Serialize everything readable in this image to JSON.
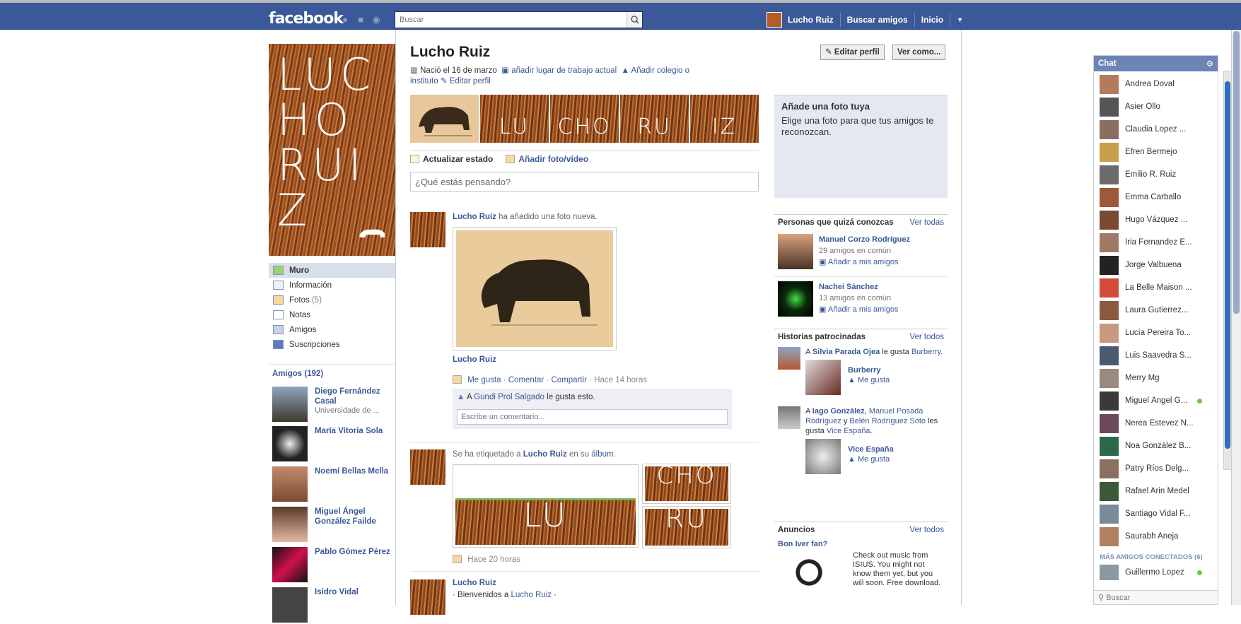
{
  "topbar": {
    "logo": "facebook",
    "search_placeholder": "Buscar",
    "user_name": "Lucho Ruiz",
    "find_friends": "Buscar amigos",
    "home": "Inicio"
  },
  "profile": {
    "name": "Lucho Ruiz",
    "birth": "Nació el 16 de marzo",
    "add_work": "añadir lugar de trabajo actual",
    "add_school": "Añadir colegio o instituto",
    "edit_profile_link": "Editar perfil",
    "edit_profile_button": "Editar perfil",
    "view_as_button": "Ver como...",
    "cover_text": "LUCHO RUIZ",
    "photo_strip": [
      "LU",
      "CHO",
      "RU",
      "IZ"
    ]
  },
  "leftnav": {
    "items": [
      {
        "label": "Muro",
        "count": ""
      },
      {
        "label": "Información",
        "count": ""
      },
      {
        "label": "Fotos",
        "count": "(5)"
      },
      {
        "label": "Notas",
        "count": ""
      },
      {
        "label": "Amigos",
        "count": ""
      },
      {
        "label": "Suscripciones",
        "count": ""
      }
    ],
    "friends_header": "Amigos (192)",
    "friends": [
      {
        "name": "Diego Fernández Casal",
        "sub": "Universidade de ..."
      },
      {
        "name": "María Vitoria Sola",
        "sub": ""
      },
      {
        "name": "Noemí Bellas Mella",
        "sub": ""
      },
      {
        "name": "Miguel Ángel González Failde",
        "sub": ""
      },
      {
        "name": "Pablo Gómez Pérez",
        "sub": ""
      },
      {
        "name": "Isidro Vidal",
        "sub": ""
      }
    ]
  },
  "composer": {
    "update_status": "Actualizar estado",
    "add_photo": "Añadir foto/vídeo",
    "placeholder": "¿Qué estás pensando?"
  },
  "stories": {
    "s1": {
      "actor": "Lucho Ruiz",
      "action": "ha añadido una foto nueva.",
      "caption": "Lucho Ruiz",
      "like": "Me gusta",
      "comment": "Comentar",
      "share": "Compartir",
      "time": "Hace 14 horas",
      "likes_prefix": "A",
      "liker": "Gundi Prol Salgado",
      "likes_suffix": "le gusta esto.",
      "comment_placeholder": "Escribe un comentario..."
    },
    "s2": {
      "prefix": "Se ha etiquetado a",
      "actor": "Lucho Ruiz",
      "middle": "en su",
      "album": "álbum",
      "tiles": [
        "LU",
        "CHO",
        "RU"
      ],
      "time": "Hace 20 horas"
    },
    "s3": {
      "actor": "Lucho Ruiz",
      "text_prefix": "· Bienvenidos a",
      "text_link": "Lucho Ruiz",
      "text_suffix": "·"
    }
  },
  "right": {
    "add_photo_title": "Añade una foto tuya",
    "add_photo_text": "Elige una foto para que tus amigos te reconozcan.",
    "pymk_header": "Personas que quizá conozcas",
    "pymk_see_all": "Ver todas",
    "pymk": [
      {
        "name": "Manuel Corzo Rodríguez",
        "mutual": "29 amigos en común",
        "add": "Añadir a mis amigos"
      },
      {
        "name": "Nachei Sánchez",
        "mutual": "13 amigos en común",
        "add": "Añadir a mis amigos"
      }
    ],
    "sponsored_header": "Historias patrocinadas",
    "sponsored_see_all": "Ver todos",
    "sp1": {
      "a": "A",
      "name": "Silvia Parada Ojea",
      "likes": "le gusta",
      "page": "Burberry",
      "page_title": "Burberry",
      "like": "Me gusta"
    },
    "sp2": {
      "a": "A",
      "n1": "Iago González",
      "n2": "Manuel Posada Rodríguez",
      "y": "y",
      "n3": "Belén Rodríguez Soto",
      "les": "les gusta",
      "page": "Vice España",
      "page_title": "Vice España",
      "like": "Me gusta"
    },
    "ads_header": "Anuncios",
    "ads_see_all": "Ver todos",
    "ad_title": "Bon Iver fan?",
    "ad_text": "Check out music from ISIUS. You might not know them yet, but you will soon. Free download."
  },
  "chat": {
    "title": "Chat",
    "friends": [
      {
        "name": "Andrea Doval",
        "online": false
      },
      {
        "name": "Asier Ollo",
        "online": false
      },
      {
        "name": "Claudia Lopez ...",
        "online": false
      },
      {
        "name": "Efren Bermejo",
        "online": false
      },
      {
        "name": "Emilio R. Ruiz",
        "online": false
      },
      {
        "name": "Emma Carballo",
        "online": false
      },
      {
        "name": "Hugo Vázquez ...",
        "online": false
      },
      {
        "name": "Iria Fernandez E...",
        "online": false
      },
      {
        "name": "Jorge Valbuena",
        "online": false
      },
      {
        "name": "La Belle Maison ...",
        "online": false
      },
      {
        "name": "Laura Gutierrez...",
        "online": false
      },
      {
        "name": "Lucía Pereira To...",
        "online": false
      },
      {
        "name": "Luis Saavedra S...",
        "online": false
      },
      {
        "name": "Merry Mg",
        "online": false
      },
      {
        "name": "Miguel Ángel G...",
        "online": true
      },
      {
        "name": "Nerea Estevez N...",
        "online": false
      },
      {
        "name": "Noa González B...",
        "online": false
      },
      {
        "name": "Patry Ríos Delg...",
        "online": false
      },
      {
        "name": "Rafael Arin Medel",
        "online": false
      },
      {
        "name": "Santiago Vidal F...",
        "online": false
      },
      {
        "name": "Saurabh Aneja",
        "online": false
      }
    ],
    "more_header": "MÁS AMIGOS CONECTADOS (6)",
    "more": [
      {
        "name": "Guillermo Lopez",
        "online": true
      }
    ],
    "search_placeholder": "Buscar"
  },
  "colors": {
    "brand": "#3b5998",
    "online": "#6bc64a"
  }
}
